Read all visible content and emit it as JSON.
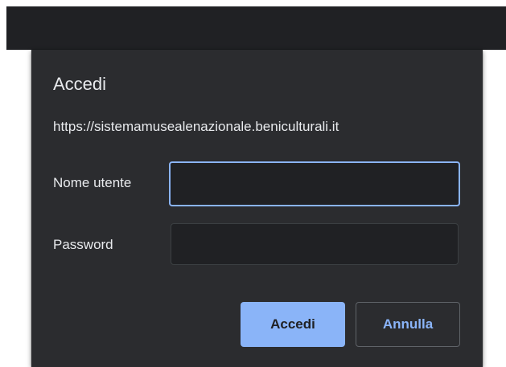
{
  "dialog": {
    "title": "Accedi",
    "origin": "https://sistemamusealenazionale.beniculturali.it",
    "username": {
      "label": "Nome utente",
      "value": "",
      "placeholder": ""
    },
    "password": {
      "label": "Password",
      "value": "",
      "placeholder": ""
    },
    "buttons": {
      "sign_in": "Accedi",
      "cancel": "Annulla"
    }
  },
  "colors": {
    "top_bar": "#202124",
    "dialog_background": "#2b2c2f",
    "text": "#e8eaed",
    "accent": "#8ab4f8"
  }
}
